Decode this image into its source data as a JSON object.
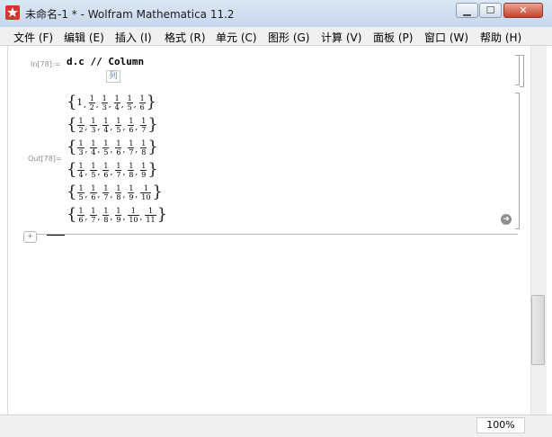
{
  "window": {
    "title": "未命名-1 * - Wolfram Mathematica 11.2",
    "buttons": [
      "minimize",
      "maximize",
      "close"
    ]
  },
  "menu": [
    {
      "label": "文件 (F)"
    },
    {
      "label": "编辑 (E)"
    },
    {
      "label": "插入 (I)"
    },
    {
      "label": "格式 (R)"
    },
    {
      "label": "单元 (C)"
    },
    {
      "label": "图形 (G)"
    },
    {
      "label": "计算 (V)"
    },
    {
      "label": "面板 (P)"
    },
    {
      "label": "窗口 (W)"
    },
    {
      "label": "帮助 (H)"
    }
  ],
  "cell": {
    "in_label": "In[78]:=",
    "input": "d.c // Column",
    "hint": "列",
    "out_label": "Out[78]=",
    "output_rows": [
      [
        "1",
        "1/2",
        "1/3",
        "1/4",
        "1/5",
        "1/6"
      ],
      [
        "1/2",
        "1/3",
        "1/4",
        "1/5",
        "1/6",
        "1/7"
      ],
      [
        "1/3",
        "1/4",
        "1/5",
        "1/6",
        "1/7",
        "1/8"
      ],
      [
        "1/4",
        "1/5",
        "1/6",
        "1/7",
        "1/8",
        "1/9"
      ],
      [
        "1/5",
        "1/6",
        "1/7",
        "1/8",
        "1/9",
        "1/10"
      ],
      [
        "1/6",
        "1/7",
        "1/8",
        "1/9",
        "1/10",
        "1/11"
      ]
    ]
  },
  "status": {
    "zoom": "100%"
  },
  "colors": {
    "title_bar": "#c6d7ec",
    "close_button": "#c7432c",
    "label_gray": "#8d8d8d"
  }
}
